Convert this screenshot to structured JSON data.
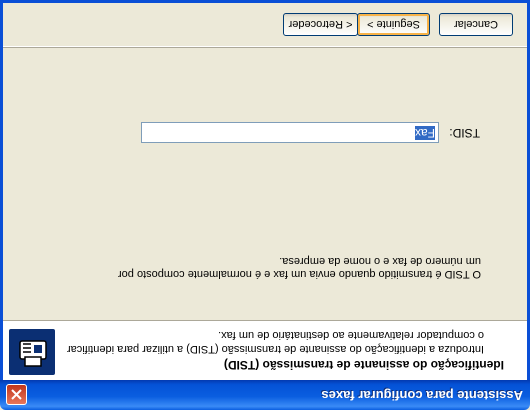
{
  "window": {
    "title": "Assistente para configurar faxes"
  },
  "header": {
    "title": "Identificação do assinante de transmissão (TSID)",
    "subtitle": "Introduza a identificação do assinante de transmissão (TSID) a utilizar para identificar o computador relativamente ao destinatário de um fax."
  },
  "content": {
    "description": "O TSID é transmitido quando envia um fax e é normalmente composto por um número de fax e o nome da empresa.",
    "tsid_label": "TSID:",
    "tsid_value": "Fax"
  },
  "buttons": {
    "back": "< Retroceder",
    "next": "Seguinte >",
    "cancel": "Cancelar"
  },
  "colors": {
    "titlebar": "#0a5ee0",
    "dialog_bg": "#ece9d8",
    "selection": "#316ac5"
  },
  "icons": {
    "close": "close-icon",
    "wizard": "fax-wizard-icon"
  }
}
